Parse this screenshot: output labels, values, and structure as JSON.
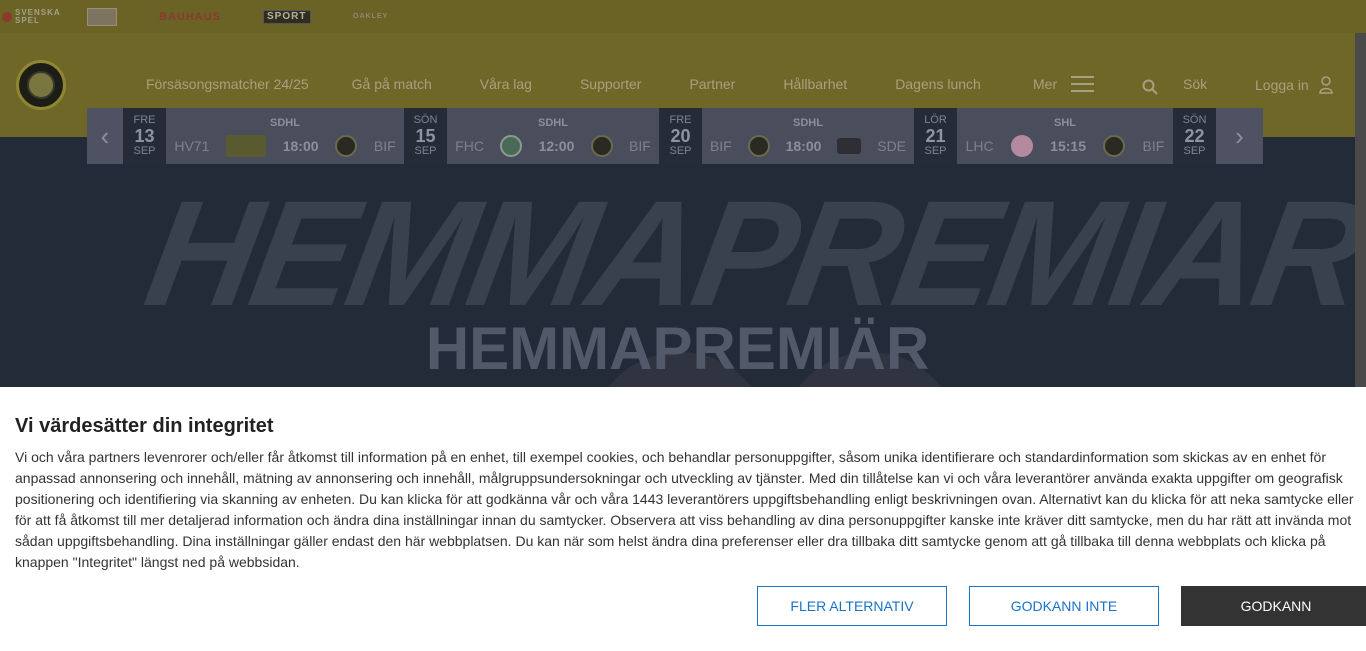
{
  "sponsors": [
    "SVENSKA SPEL",
    "",
    "BAUHAUS",
    "SPORT",
    "OAKLEY"
  ],
  "nav": {
    "items": [
      "Försäsongsmatcher 24/25",
      "Gå på match",
      "Våra lag",
      "Supporter",
      "Partner",
      "Hållbarhet",
      "Dagens lunch"
    ],
    "more": "Mer",
    "search": "Sök",
    "login": "Logga in"
  },
  "schedule": [
    {
      "dow": "FRE",
      "day": "13",
      "mon": "SEP",
      "league": "SDHL",
      "home": "HV71",
      "time": "18:00",
      "away": "BIF"
    },
    {
      "dow": "SÖN",
      "day": "15",
      "mon": "SEP",
      "league": "SDHL",
      "home": "FHC",
      "time": "12:00",
      "away": "BIF"
    },
    {
      "dow": "FRE",
      "day": "20",
      "mon": "SEP",
      "league": "SDHL",
      "home": "BIF",
      "time": "18:00",
      "away": "SDE"
    },
    {
      "dow": "LÖR",
      "day": "21",
      "mon": "SEP",
      "league": "SHL",
      "home": "LHC",
      "time": "15:15",
      "away": "BIF"
    },
    {
      "dow": "SÖN",
      "day": "22",
      "mon": "SEP"
    }
  ],
  "hero": {
    "bg_text": "HEMMAPREMIAR",
    "title": "HEMMAPREMIÄR"
  },
  "consent": {
    "title": "Vi värdesätter din integritet",
    "body": "Vi och våra partners levenrorer och/eller får åtkomst till information på en enhet, till exempel cookies, och behandlar personuppgifter, såsom unika identifierare och standardinformation som skickas av en enhet för anpassad annonsering och innehåll, mätning av annonsering och innehåll, målgruppsundersokningar och utveckling av tjänster. Med din tillåtelse kan vi och våra leverantörer använda exakta uppgifter om geografisk positionering och identifiering via skanning av enheten. Du kan klicka för att godkänna vår och våra 1443 leverantörers uppgiftsbehandling enligt beskrivningen ovan. Alternativt kan du klicka för att neka samtycke eller för att få åtkomst till mer detaljerad information och ändra dina inställningar innan du samtycker. Observera att viss behandling av dina personuppgifter kanske inte kräver ditt samtycke, men du har rätt att invända mot sådan uppgiftsbehandling. Dina inställningar gäller endast den här webbplatsen. Du kan när som helst ändra dina preferenser eller dra tillbaka ditt samtycke genom att gå tillbaka till denna webbplats och klicka på knappen \"Integritet\" längst ned på webbsidan.",
    "more_options": "FLER ALTERNATIV",
    "reject": "GODKANN INTE",
    "accept": "GODKANN"
  }
}
